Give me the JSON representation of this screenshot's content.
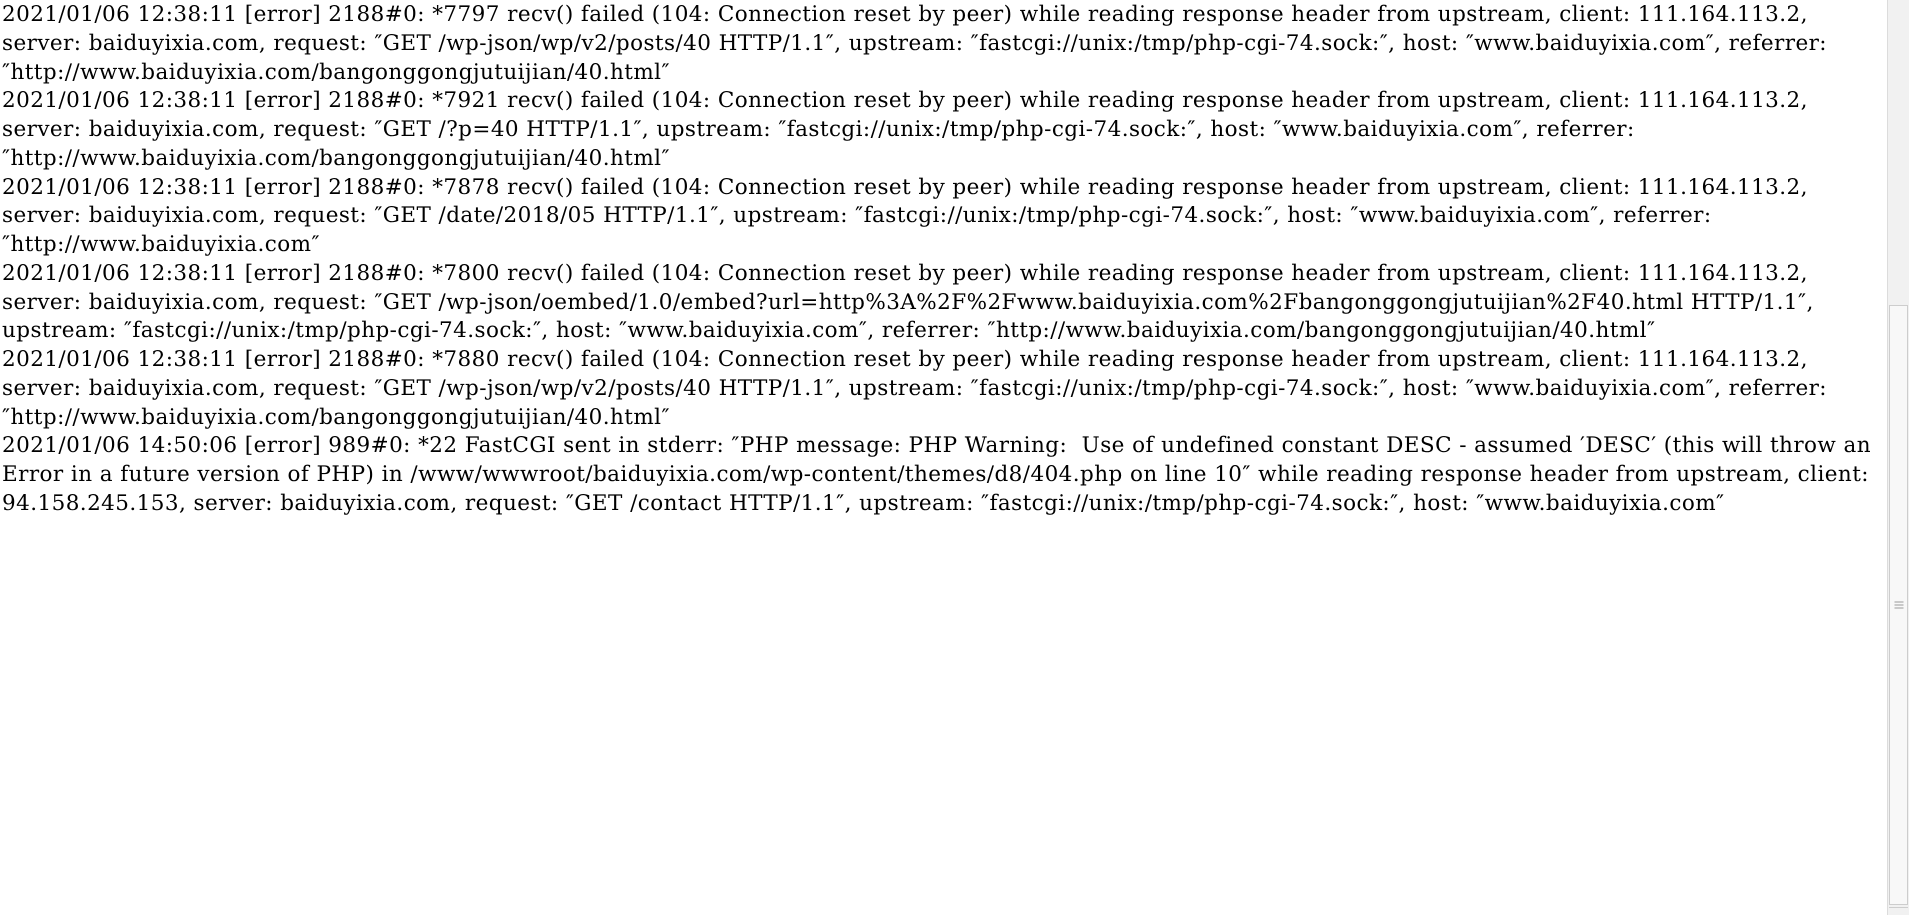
{
  "page": {
    "kind": "nginx-error-log",
    "background_color": "#ffffff",
    "text_color": "#000000"
  },
  "scrollbar": {
    "name": "vertical-scrollbar",
    "track_color": "#f1f1f1",
    "thumb_color": "#f8f8f8",
    "thumb_border_color": "#cdcdcd"
  },
  "log": {
    "entries": [
      "2021/01/06 12:38:11 [error] 2188#0: *7797 recv() failed (104: Connection reset by peer) while reading response header from upstream, client: 111.164.113.2, server: baiduyixia.com, request: ″GET /wp-json/wp/v2/posts/40 HTTP/1.1″, upstream: ″fastcgi://unix:/tmp/php-cgi-74.sock:″, host: ″www.baiduyixia.com″, referrer: ″http://www.baiduyixia.com/bangonggongjutuijian/40.html″",
      "2021/01/06 12:38:11 [error] 2188#0: *7921 recv() failed (104: Connection reset by peer) while reading response header from upstream, client: 111.164.113.2, server: baiduyixia.com, request: ″GET /?p=40 HTTP/1.1″, upstream: ″fastcgi://unix:/tmp/php-cgi-74.sock:″, host: ″www.baiduyixia.com″, referrer: ″http://www.baiduyixia.com/bangonggongjutuijian/40.html″",
      "2021/01/06 12:38:11 [error] 2188#0: *7878 recv() failed (104: Connection reset by peer) while reading response header from upstream, client: 111.164.113.2, server: baiduyixia.com, request: ″GET /date/2018/05 HTTP/1.1″, upstream: ″fastcgi://unix:/tmp/php-cgi-74.sock:″, host: ″www.baiduyixia.com″, referrer: ″http://www.baiduyixia.com″",
      "2021/01/06 12:38:11 [error] 2188#0: *7800 recv() failed (104: Connection reset by peer) while reading response header from upstream, client: 111.164.113.2, server: baiduyixia.com, request: ″GET /wp-json/oembed/1.0/embed?url=http%3A%2F%2Fwww.baiduyixia.com%2Fbangonggongjutuijian%2F40.html HTTP/1.1″, upstream: ″fastcgi://unix:/tmp/php-cgi-74.sock:″, host: ″www.baiduyixia.com″, referrer: ″http://www.baiduyixia.com/bangonggongjutuijian/40.html″",
      "2021/01/06 12:38:11 [error] 2188#0: *7880 recv() failed (104: Connection reset by peer) while reading response header from upstream, client: 111.164.113.2, server: baiduyixia.com, request: ″GET /wp-json/wp/v2/posts/40 HTTP/1.1″, upstream: ″fastcgi://unix:/tmp/php-cgi-74.sock:″, host: ″www.baiduyixia.com″, referrer: ″http://www.baiduyixia.com/bangonggongjutuijian/40.html″",
      "2021/01/06 14:50:06 [error] 989#0: *22 FastCGI sent in stderr: ″PHP message: PHP Warning:  Use of undefined constant DESC - assumed ′DESC′ (this will throw an Error in a future version of PHP) in /www/wwwroot/baiduyixia.com/wp-content/themes/d8/404.php on line 10″ while reading response header from upstream, client: 94.158.245.153, server: baiduyixia.com, request: ″GET /contact HTTP/1.1″, upstream: ″fastcgi://unix:/tmp/php-cgi-74.sock:″, host: ″www.baiduyixia.com″"
    ]
  }
}
